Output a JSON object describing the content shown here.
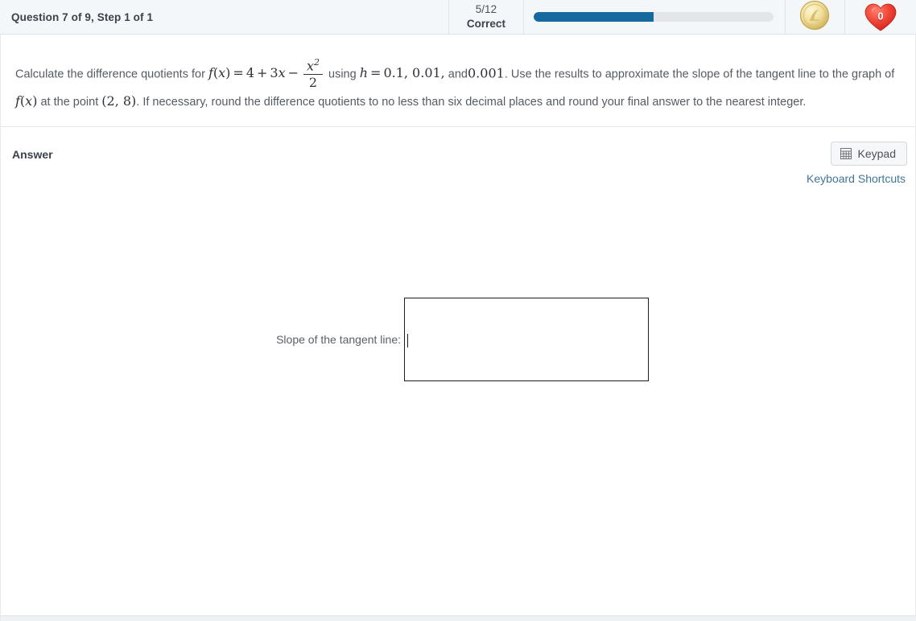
{
  "header": {
    "question_title": "Question 7 of 9, Step 1 of 1",
    "score_fraction": "5/12",
    "score_label": "Correct",
    "progress_percent": 50,
    "progress_fill_color": "#16699e",
    "progress_track_color": "#e3e5e6",
    "coin_icon": "gold-coin-icon",
    "heart_icon": "red-heart-icon",
    "heart_count": "0",
    "heart_color": "#e8382a",
    "coin_color": "#e8d48a"
  },
  "question": {
    "text_part_1": "Calculate the difference quotients for",
    "fn_f": "f",
    "fn_paren_open": "(",
    "fn_x": "x",
    "fn_paren_close": ")",
    "equals": "=",
    "expr_4": "4",
    "plus": "+",
    "expr_3x_coef": "3",
    "expr_3x_var": "x",
    "minus": "−",
    "frac_numerator_base": "x",
    "frac_numerator_exp": "2",
    "frac_denominator": "2",
    "text_using": "using",
    "var_h": "h",
    "h_values": "0.1, 0.01,",
    "text_and": "and",
    "h_value_last": "0.001",
    "text_part_2": ". Use the results to approximate the slope of the tangent line to the graph",
    "text_part_3": "of",
    "text_part_4": "at the point",
    "point_value": "(2, 8)",
    "text_part_5": ". If necessary, round the difference quotients to no less than six decimal places and round your final answer to the nearest integer."
  },
  "answer": {
    "section_title": "Answer",
    "keypad_label": "Keypad",
    "keypad_icon": "keypad-grid-icon",
    "keyboard_shortcuts_label": "Keyboard Shortcuts",
    "keyboard_shortcuts_color": "#3f7695",
    "input_label": "Slope of the tangent line:",
    "input_value": "",
    "input_placeholder": ""
  }
}
